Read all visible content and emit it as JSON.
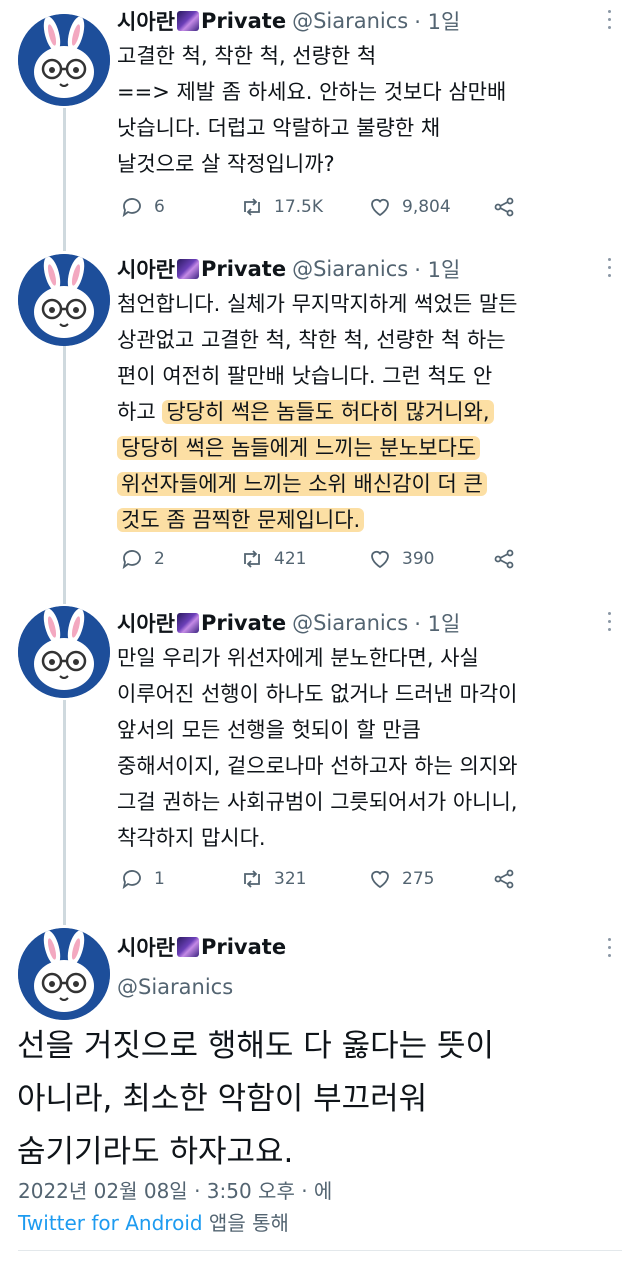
{
  "tweets": [
    {
      "name": "시아란",
      "badge": "Private",
      "handle": "@Siaranics",
      "time": "· 1일",
      "lines": [
        "고결한 척, 착한 척, 선량한 척",
        "==> 제발 좀 하세요. 안하는 것보다 삼만배",
        "낫습니다. 더럽고 악랄하고 불량한 채",
        "날것으로 살 작정입니까?"
      ],
      "replies": "6",
      "retweets": "17.5K",
      "likes": "9,804"
    },
    {
      "name": "시아란",
      "badge": "Private",
      "handle": "@Siaranics",
      "time": "· 1일",
      "lines": [
        "첨언합니다. 실체가 무지막지하게 썩었든 말든",
        "상관없고 고결한 척, 착한 척, 선량한 척 하는",
        "편이 여전히 팔만배 낫습니다. 그런 척도 안",
        "하고 ",
        "당당히 썩은 놈들도 허다히 많거니와,",
        "당당히 썩은 놈들에게 느끼는 분노보다도",
        "위선자들에게 느끼는 소위 배신감이 더 큰",
        "것도 좀 끔찍한 문제입니다."
      ],
      "replies": "2",
      "retweets": "421",
      "likes": "390"
    },
    {
      "name": "시아란",
      "badge": "Private",
      "handle": "@Siaranics",
      "time": "· 1일",
      "lines": [
        "만일 우리가 위선자에게 분노한다면, 사실",
        "이루어진 선행이 하나도 없거나 드러낸 마각이",
        "앞서의 모든 선행을 헛되이 할 만큼",
        "중해서이지, 겉으로나마 선하고자 하는 의지와",
        "그걸 권하는 사회규범이 그릇되어서가 아니니,",
        "착각하지 맙시다."
      ],
      "replies": "1",
      "retweets": "321",
      "likes": "275"
    }
  ],
  "main_tweet": {
    "name": "시아란",
    "badge": "Private",
    "handle": "@Siaranics",
    "lines": [
      "선을 거짓으로 행해도 다 옳다는 뜻이",
      "아니라, 최소한 악함이 부끄러워",
      "숨기기라도 하자고요."
    ],
    "timestamp": "2022년 02월 08일 · 3:50 오후 · 에",
    "source_app": "Twitter for Android",
    "source_suffix": " 앱을 통해"
  },
  "colors": {
    "avatar_bg": "#1d4e9a",
    "highlight": "#fac45a",
    "link": "#1d9bf0",
    "secondary_text": "#536471"
  },
  "icons": {
    "reply": "reply-icon",
    "retweet": "retweet-icon",
    "like": "like-icon",
    "share": "share-icon",
    "more": "more-icon"
  }
}
